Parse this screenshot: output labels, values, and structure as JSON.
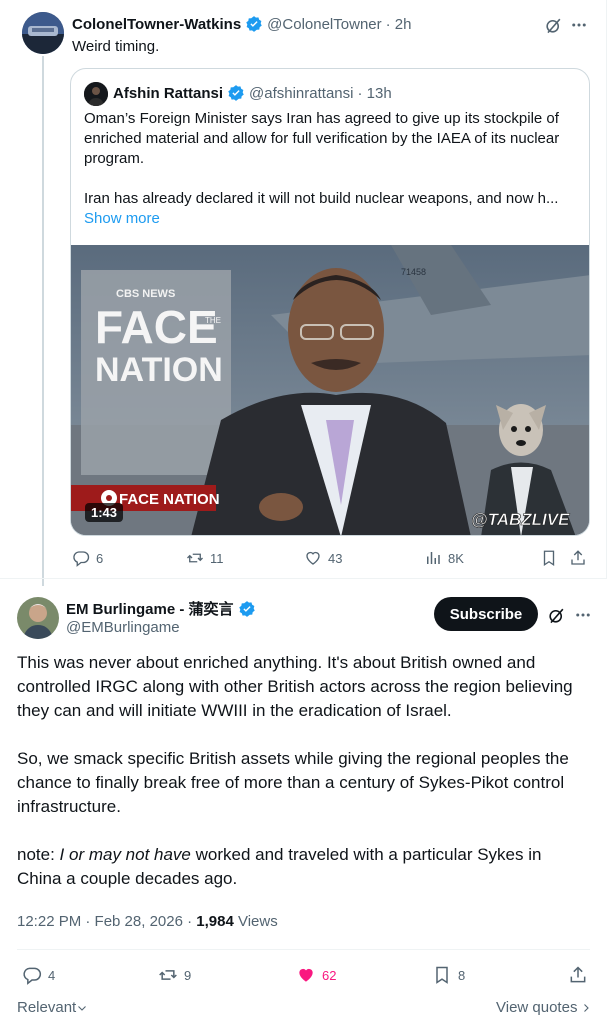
{
  "tweet1": {
    "name": "ColonelTowner-Watkins",
    "handle": "@ColonelTowner",
    "time": "· 2h",
    "text": "Weird timing.",
    "quote": {
      "name": "Afshin Rattansi",
      "handle": "@afshinrattansi",
      "time": "· 13h",
      "para1": "Oman’s Foreign Minister says Iran has agreed to give up its stockpile of enriched material and allow for full verification by the IAEA of its nuclear program.",
      "para2": "Iran has already declared it will not build nuclear weapons, and now h...",
      "show_more": "Show more",
      "media": {
        "brand": "CBS NEWS",
        "show_line1": "FACE",
        "show_the": "THE",
        "show_line2": "NATION",
        "lower_third": "FACE NATION",
        "watermark": "@TABZLIVE",
        "tail_number": "71458",
        "duration": "1:43"
      }
    },
    "actions": {
      "replies": "6",
      "reposts": "11",
      "likes": "43",
      "views": "8K"
    }
  },
  "tweet2": {
    "name": "EM Burlingame - 蒲奕言",
    "handle": "@EMBurlingame",
    "subscribe": "Subscribe",
    "para1": "This was never about enriched anything. It's about British owned and controlled IRGC along with other British actors across the region believing they can and will initiate WWIII in the eradication of Israel.",
    "para2": "So, we smack specific British assets while giving the regional peoples the chance to finally break free of more than a century of Sykes-Pikot control infrastructure.",
    "para3_prefix": "note: ",
    "para3_italic": "I or may not have",
    "para3_suffix": " worked and traveled with a particular Sykes in China a couple decades ago.",
    "timestamp": "12:22 PM · Feb 28, 2026 · ",
    "views_count": "1,984",
    "views_label": " Views",
    "actions": {
      "replies": "4",
      "reposts": "9",
      "likes": "62",
      "bookmarks": "8"
    },
    "relevant": "Relevant",
    "view_quotes": "View quotes"
  },
  "colors": {
    "accent": "#1d9bf0",
    "like": "#f91880",
    "text": "#0f1419",
    "muted": "#536471"
  }
}
